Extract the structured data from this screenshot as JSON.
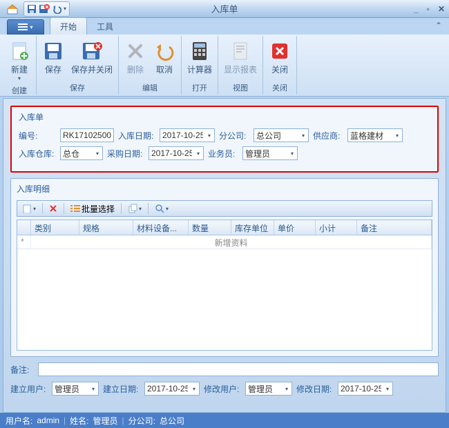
{
  "window": {
    "title": "入库单"
  },
  "tabs": {
    "start": "开始",
    "tools": "工具"
  },
  "ribbon": {
    "new": "新建",
    "save": "保存",
    "saveClose": "保存并关闭",
    "delete": "删除",
    "cancel": "取消",
    "calc": "计算器",
    "report": "显示报表",
    "close": "关闭",
    "grpCreate": "创建",
    "grpSave": "保存",
    "grpEdit": "编辑",
    "grpOpen": "打开",
    "grpView": "视图",
    "grpClose": "关闭"
  },
  "form": {
    "title": "入库单",
    "codeLabel": "编号:",
    "code": "RK17102500",
    "inDateLabel": "入库日期:",
    "inDate": "2017-10-25",
    "branchLabel": "分公司:",
    "branch": "总公司",
    "supplierLabel": "供应商:",
    "supplier": "蓝格建材",
    "whLabel": "入库仓库:",
    "wh": "总仓",
    "poDateLabel": "采购日期:",
    "poDate": "2017-10-25",
    "opLabel": "业务员:",
    "op": "管理员"
  },
  "detail": {
    "title": "入库明细",
    "batch": "批量选择",
    "cols": [
      "",
      "类别",
      "规格",
      "材料设备...",
      "数量",
      "库存单位",
      "单价",
      "小计",
      "备注"
    ],
    "newRow": "新增资料"
  },
  "remark": {
    "label": "备注:",
    "value": ""
  },
  "meta": {
    "createUserL": "建立用户:",
    "createUser": "管理员",
    "createDateL": "建立日期:",
    "createDate": "2017-10-25",
    "modUserL": "修改用户:",
    "modUser": "管理员",
    "modDateL": "修改日期:",
    "modDate": "2017-10-25"
  },
  "status": {
    "userL": "用户名:",
    "user": "admin",
    "nameL": "姓名:",
    "name": "管理员",
    "branchL": "分公司:",
    "branch": "总公司"
  }
}
